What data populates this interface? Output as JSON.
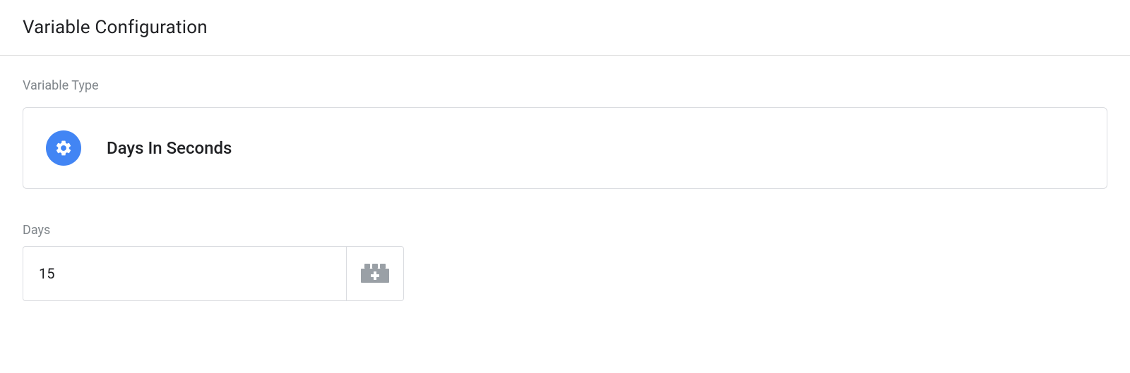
{
  "header": {
    "title": "Variable Configuration"
  },
  "variableType": {
    "label": "Variable Type",
    "name": "Days In Seconds"
  },
  "fields": {
    "days": {
      "label": "Days",
      "value": "15"
    }
  }
}
